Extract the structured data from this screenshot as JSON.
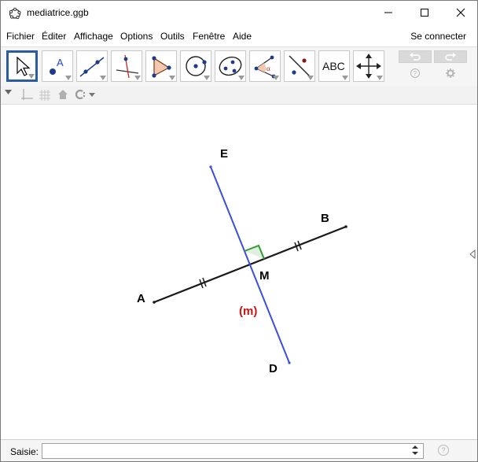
{
  "window": {
    "title": "mediatrice.ggb"
  },
  "menu": {
    "items": [
      "Fichier",
      "Éditer",
      "Affichage",
      "Options",
      "Outils",
      "Fenêtre",
      "Aide"
    ],
    "connect": "Se connecter"
  },
  "toolbar": {
    "tools": [
      {
        "name": "move-tool",
        "icon": "pointer-icon"
      },
      {
        "name": "point-tool",
        "icon": "point-icon"
      },
      {
        "name": "line-tool",
        "icon": "line-icon"
      },
      {
        "name": "perpendicular-tool",
        "icon": "perpendicular-icon"
      },
      {
        "name": "polygon-tool",
        "icon": "polygon-icon"
      },
      {
        "name": "circle-tool",
        "icon": "circle-icon"
      },
      {
        "name": "conic-tool",
        "icon": "ellipse-icon"
      },
      {
        "name": "angle-tool",
        "icon": "angle-icon"
      },
      {
        "name": "reflect-tool",
        "icon": "reflect-icon"
      },
      {
        "name": "text-tool",
        "icon": "text-icon",
        "label": "ABC"
      },
      {
        "name": "move-view-tool",
        "icon": "move-graphics-icon"
      }
    ],
    "angle_symbol": "α"
  },
  "graphics": {
    "points": {
      "A": "A",
      "B": "B",
      "E": "E",
      "D": "D",
      "M": "M"
    },
    "bisector_label": "(m)",
    "colors": {
      "segment": "#1a1a1a",
      "bisector": "#3a4ee0",
      "right_angle": "#2f9a2f",
      "label_m": "#cc1111"
    }
  },
  "inputbar": {
    "label": "Saisie:",
    "value": ""
  }
}
